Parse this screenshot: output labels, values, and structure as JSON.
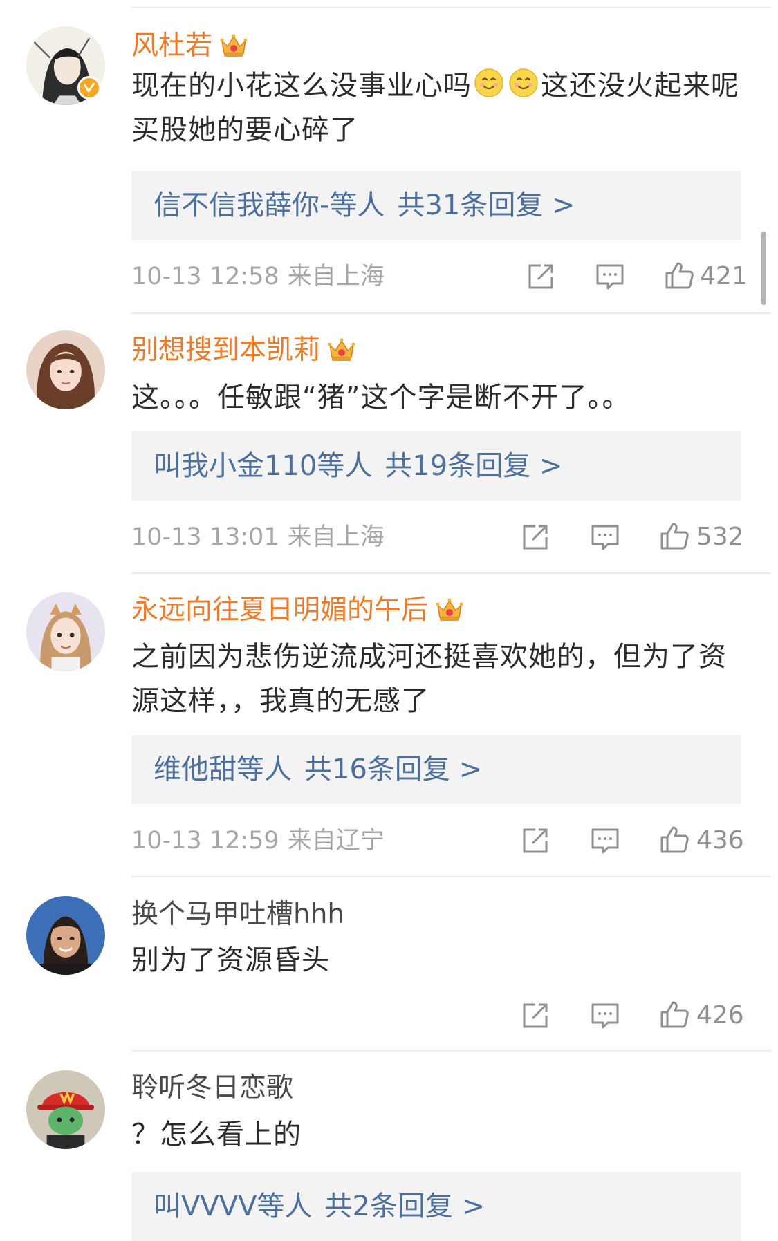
{
  "comments": [
    {
      "username": "风杜若",
      "verified": true,
      "crown": true,
      "text_before": "现在的小花这么没事业心吗",
      "emoji_count": 2,
      "text_after": "这还没火起来呢 买股她的要心碎了",
      "replies": {
        "names": "信不信我薛你-",
        "mid": "等人",
        "count": "共31条回复 >"
      },
      "time": "10-13 12:58",
      "location": "来自上海",
      "likes": "421"
    },
    {
      "username": "别想搜到本凯莉",
      "verified": false,
      "crown": true,
      "text": "这。。。任敏跟“猪”这个字是断不开了。。",
      "replies": {
        "names": "叫我小金110",
        "mid": "等人",
        "count": "共19条回复 >"
      },
      "time": "10-13 13:01",
      "location": "来自上海",
      "likes": "532"
    },
    {
      "username": "永远向往夏日明媚的午后",
      "verified": false,
      "crown": true,
      "text": "之前因为悲伤逆流成河还挺喜欢她的，但为了资源这样，，我真的无感了",
      "replies": {
        "names": "维他甜",
        "mid": "等人",
        "count": "共16条回复 >"
      },
      "time": "10-13 12:59",
      "location": "来自辽宁",
      "likes": "436"
    },
    {
      "username": "换个马甲吐槽hhh",
      "verified": false,
      "crown": false,
      "text": "别为了资源昏头",
      "likes": "426"
    },
    {
      "username": "聆听冬日恋歌",
      "verified": false,
      "crown": false,
      "text": "？怎么看上的",
      "replies": {
        "names": "叫VVVV",
        "mid": "等人",
        "count": "共2条回复 >"
      }
    }
  ],
  "icons": {
    "share": "share-icon",
    "comment": "comment-icon",
    "like": "thumbs-up-icon",
    "crown": "crown-badge-icon",
    "verified": "verified-v-icon",
    "emoji": "smiling-face-emoji"
  },
  "colors": {
    "username_vip": "#ec7b2a",
    "username_plain": "#4a4a4a",
    "reply_link": "#4c6f9c",
    "meta_gray": "#a6a6a6",
    "reply_bg": "#f3f3f3",
    "verified_badge": "#f5a623"
  }
}
